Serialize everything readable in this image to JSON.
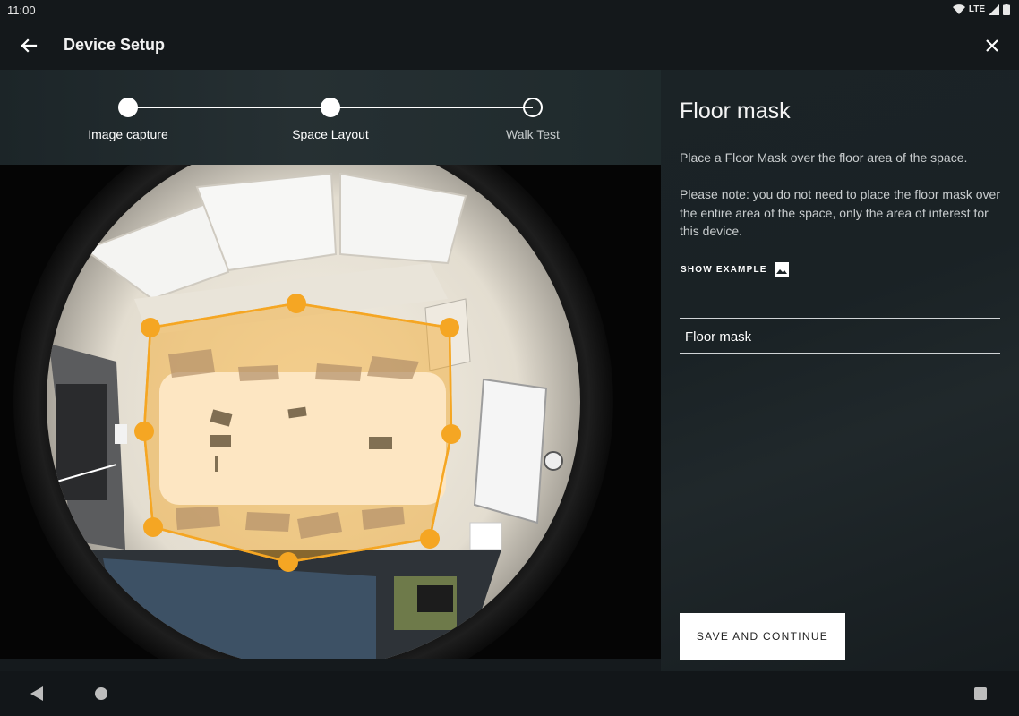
{
  "status_bar": {
    "time": "11:00",
    "network": "LTE"
  },
  "app_bar": {
    "title": "Device Setup",
    "back_icon": "arrow-left-icon",
    "close_icon": "close-icon"
  },
  "stepper": {
    "steps": [
      {
        "label": "Image capture",
        "state": "completed"
      },
      {
        "label": "Space Layout",
        "state": "current"
      },
      {
        "label": "Walk Test",
        "state": "pending"
      }
    ]
  },
  "camera": {
    "mask_color": "#f5a623",
    "mask_label": "Floor mask"
  },
  "panel": {
    "title": "Floor mask",
    "description": "Place a Floor Mask over the floor area of the space.",
    "note": "Please note: you do not need to place the floor mask over the entire area of the space, only the area of interest for this device.",
    "show_example": "SHOW EXAMPLE",
    "show_example_icon": "image-icon",
    "mask_list": [
      "Floor mask"
    ],
    "save_button": "SAVE AND CONTINUE"
  },
  "nav_bar": {
    "back_icon": "nav-back-icon",
    "home_icon": "nav-home-icon",
    "recents_icon": "nav-recents-icon"
  }
}
